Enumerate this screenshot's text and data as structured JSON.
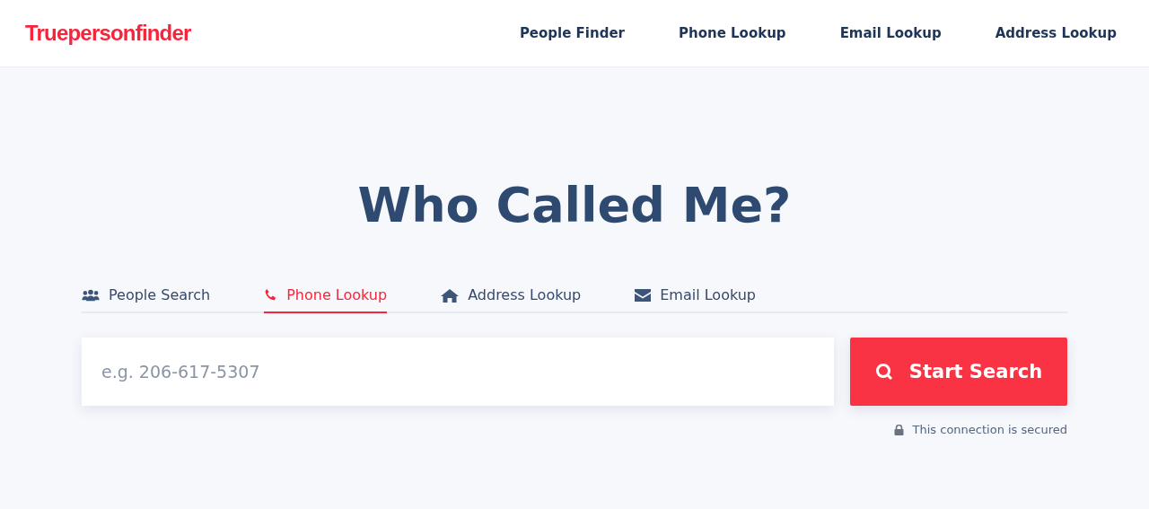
{
  "header": {
    "logo": "Truepersonfinder",
    "nav": [
      "People Finder",
      "Phone Lookup",
      "Email Lookup",
      "Address Lookup"
    ]
  },
  "hero": {
    "title": "Who Called Me?"
  },
  "tabs": [
    {
      "label": "People Search",
      "kind": "people",
      "selected": false
    },
    {
      "label": "Phone Lookup",
      "kind": "phone",
      "selected": true
    },
    {
      "label": "Address Lookup",
      "kind": "house",
      "selected": false
    },
    {
      "label": "Email Lookup",
      "kind": "envelope",
      "selected": false
    }
  ],
  "search": {
    "placeholder": "e.g. 206-617-5307",
    "button": "Start Search",
    "secure_note": "This connection is secured"
  }
}
